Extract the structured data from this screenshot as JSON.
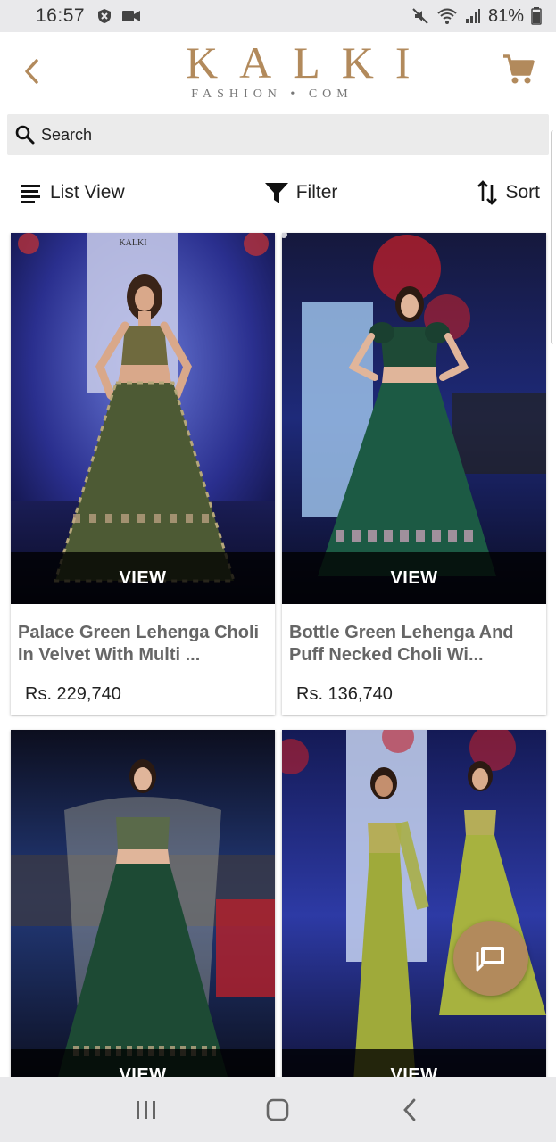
{
  "status_bar": {
    "time": "16:57",
    "battery": "81%"
  },
  "header": {
    "logo_main": "KALKI",
    "logo_sub": "FASHION • COM",
    "brand_color": "#b28a5c"
  },
  "search": {
    "label": "Search"
  },
  "toolbar": {
    "list_view": "List View",
    "filter": "Filter",
    "sort": "Sort"
  },
  "products": [
    {
      "title": "Palace Green Lehenga Choli In Velvet With Multi ...",
      "price": "Rs. 229,740",
      "view_label": "VIEW"
    },
    {
      "title": "Bottle Green Lehenga And Puff Necked Choli Wi...",
      "price": "Rs. 136,740",
      "view_label": "VIEW"
    },
    {
      "view_label": "VIEW"
    },
    {
      "view_label": "VIEW"
    }
  ],
  "icons": {
    "back": "chevron-left-icon",
    "cart": "cart-icon",
    "search": "search-icon",
    "list": "list-icon",
    "filter": "filter-icon",
    "sort": "sort-icon",
    "chat": "chat-icon"
  }
}
